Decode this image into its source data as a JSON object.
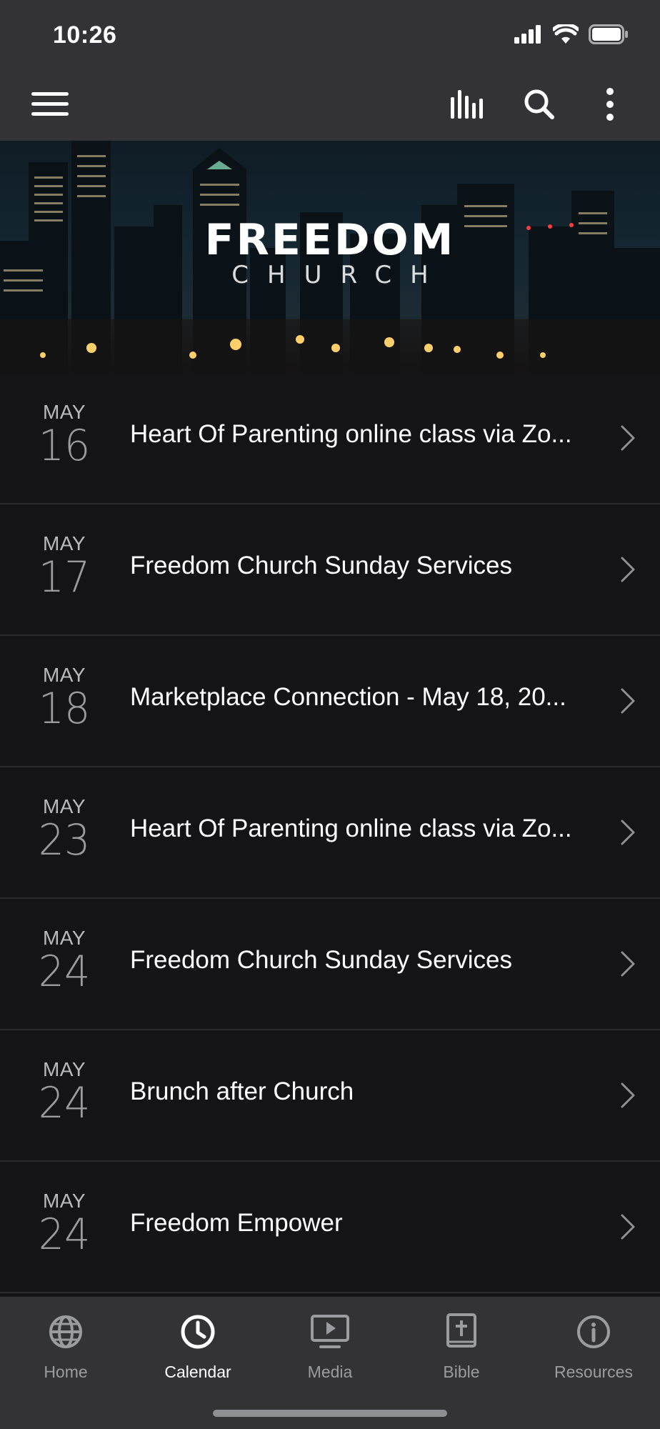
{
  "status_bar": {
    "time": "10:26"
  },
  "hero": {
    "title": "FREEDOM",
    "subtitle": "CHURCH"
  },
  "events": [
    {
      "month": "MAY",
      "day": "16",
      "title": "Heart Of Parenting online class via Zo..."
    },
    {
      "month": "MAY",
      "day": "17",
      "title": "Freedom Church Sunday Services"
    },
    {
      "month": "MAY",
      "day": "18",
      "title": "Marketplace Connection - May 18, 20..."
    },
    {
      "month": "MAY",
      "day": "23",
      "title": "Heart Of Parenting online class via Zo..."
    },
    {
      "month": "MAY",
      "day": "24",
      "title": "Freedom Church Sunday Services"
    },
    {
      "month": "MAY",
      "day": "24",
      "title": "Brunch after Church"
    },
    {
      "month": "MAY",
      "day": "24",
      "title": "Freedom Empower"
    }
  ],
  "tabs": [
    {
      "label": "Home",
      "icon": "globe-icon",
      "active": false
    },
    {
      "label": "Calendar",
      "icon": "clock-icon",
      "active": true
    },
    {
      "label": "Media",
      "icon": "play-screen-icon",
      "active": false
    },
    {
      "label": "Bible",
      "icon": "bible-icon",
      "active": false
    },
    {
      "label": "Resources",
      "icon": "info-icon",
      "active": false
    }
  ],
  "colors": {
    "bar_bg": "#333335",
    "list_bg": "#141416",
    "inactive_tab": "#9b9c9f",
    "active_tab": "#ffffff"
  }
}
